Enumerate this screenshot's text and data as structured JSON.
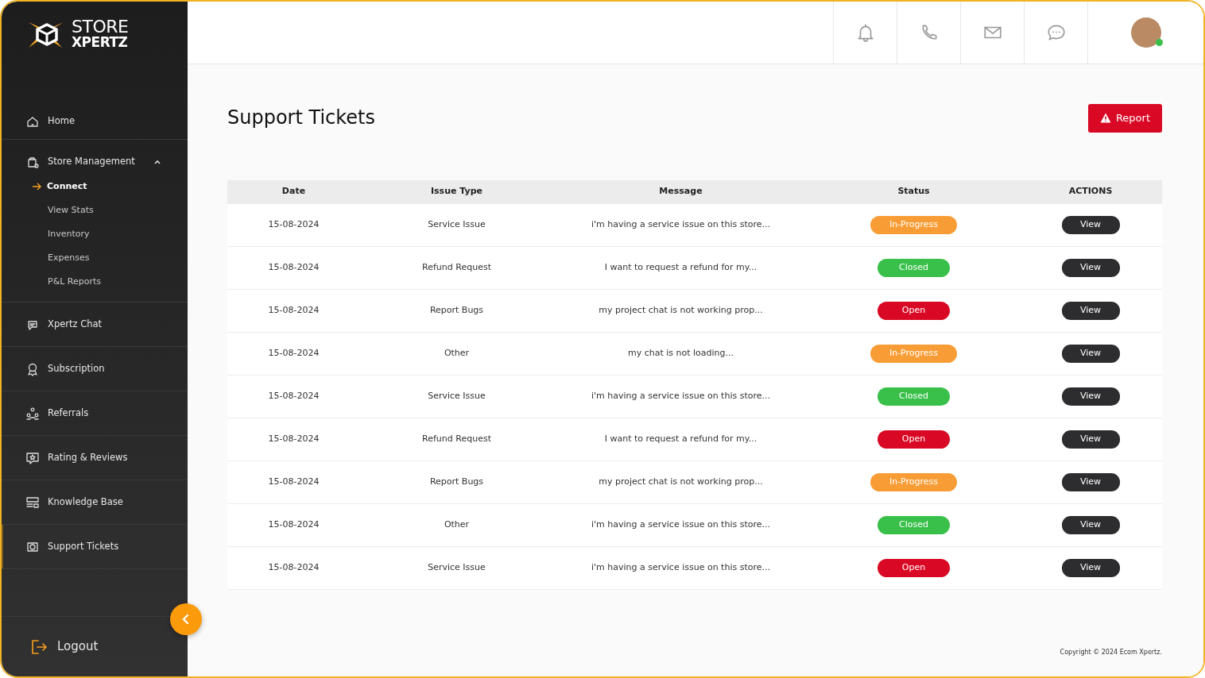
{
  "logo": {
    "line_1": "STORE",
    "line_2": "XPERTZ"
  },
  "sidebar": {
    "items": [
      {
        "label": "Home",
        "kind": "home",
        "selected": false
      },
      {
        "label": "Store Management",
        "kind": "store",
        "selected": false,
        "expanded": true,
        "children": [
          {
            "label": "Connect",
            "selected": true
          },
          {
            "label": "View Stats",
            "selected": false
          },
          {
            "label": "Inventory",
            "selected": false
          },
          {
            "label": "Expenses",
            "selected": false
          },
          {
            "label": "P&L Reports",
            "selected": false
          }
        ]
      },
      {
        "label": "Xpertz Chat",
        "kind": "chat",
        "selected": false
      },
      {
        "label": "Subscription",
        "kind": "award",
        "selected": false
      },
      {
        "label": "Referrals",
        "kind": "people",
        "selected": false
      },
      {
        "label": "Rating & Reviews",
        "kind": "star",
        "selected": false
      },
      {
        "label": "Knowledge Base",
        "kind": "layout",
        "selected": false
      },
      {
        "label": "Support Tickets",
        "kind": "support",
        "selected": true
      }
    ],
    "logout": "Logout"
  },
  "header": {
    "user": {
      "online": true
    }
  },
  "page": {
    "title": "Support Tickets",
    "report_button": "Report"
  },
  "table": {
    "columns": [
      "Date",
      "Issue Type",
      "Message",
      "Status",
      "ACTIONS"
    ],
    "rows": [
      {
        "date": "15-08-2024",
        "issue_type": "Service Issue",
        "message": "i'm having a service issue on this store...",
        "status": "In-Progress",
        "kind": "in-progress",
        "action": "View"
      },
      {
        "date": "15-08-2024",
        "issue_type": "Refund Request",
        "message": "I want to request a refund for my...",
        "status": "Closed",
        "kind": "closed",
        "action": "View"
      },
      {
        "date": "15-08-2024",
        "issue_type": "Report Bugs",
        "message": "my project chat is not working prop...",
        "status": "Open",
        "kind": "open",
        "action": "View"
      },
      {
        "date": "15-08-2024",
        "issue_type": "Other",
        "message": "my chat is not loading...",
        "status": "In-Progress",
        "kind": "in-progress",
        "action": "View"
      },
      {
        "date": "15-08-2024",
        "issue_type": "Service Issue",
        "message": "i'm having a service issue on this store...",
        "status": "Closed",
        "kind": "closed",
        "action": "View"
      },
      {
        "date": "15-08-2024",
        "issue_type": "Refund Request",
        "message": "I want to request a refund for my...",
        "status": "Open",
        "kind": "open",
        "action": "View"
      },
      {
        "date": "15-08-2024",
        "issue_type": "Report Bugs",
        "message": "my project chat is not working prop...",
        "status": "In-Progress",
        "kind": "in-progress",
        "action": "View"
      },
      {
        "date": "15-08-2024",
        "issue_type": "Other",
        "message": "i'm having a service issue on this store...",
        "status": "Closed",
        "kind": "closed",
        "action": "View"
      },
      {
        "date": "15-08-2024",
        "issue_type": "Service Issue",
        "message": "i'm having a service issue on this store...",
        "status": "Open",
        "kind": "open",
        "action": "View"
      }
    ]
  },
  "footer": {
    "copyright": "Copyright © 2024 Ecom Xpertz."
  }
}
